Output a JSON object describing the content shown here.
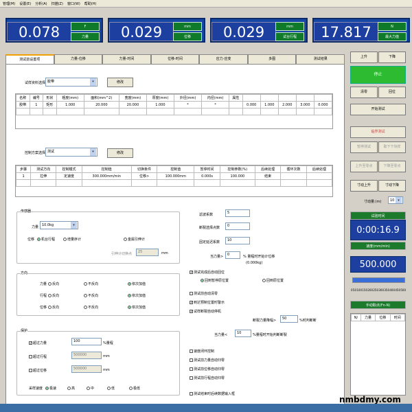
{
  "menu": [
    "管理(M)",
    "设置(E)",
    "分析(A)",
    "扫描(Z)",
    "窗口(W)",
    "帮助(H)"
  ],
  "displays": [
    {
      "value": "0.078",
      "top_label": "F",
      "name": "力量"
    },
    {
      "value": "0.029",
      "top_label": "mm",
      "name": "位移"
    },
    {
      "value": "0.029",
      "top_label": "mm",
      "name": "试台行程"
    },
    {
      "value": "17.817",
      "top_label": "N",
      "name": "最大力值"
    }
  ],
  "tabs": [
    "测试前设置项",
    "力量-位移",
    "力量-时间",
    "位移-时间",
    "应力-应变",
    "多图",
    "测试结果"
  ],
  "sample": {
    "label": "试样资料选择",
    "select": "胶带",
    "button": "修改",
    "headers": [
      "名称",
      "编号",
      "形状",
      "粗度(mm)",
      "面积(mm^2)",
      "宽度(mm)",
      "厚度(mm)",
      "外径(mm)",
      "内径(mm)",
      "属性",
      "",
      "",
      "",
      "",
      ""
    ],
    "row": [
      "胶带",
      "1",
      "矩形",
      "1.000",
      "20.000",
      "20.000",
      "1.000",
      "*",
      "*",
      "",
      "0.000",
      "1.000",
      "2.000",
      "3.000",
      "0.000"
    ]
  },
  "control": {
    "label": "控制方案选择",
    "select": "测试",
    "button": "修改",
    "headers": [
      "步骤",
      "测试方向",
      "控制模式",
      "控制值",
      "切换条件",
      "控制值",
      "暂停时间",
      "控制参数(%)",
      "后续处理",
      "循环次数",
      "后续处理"
    ],
    "row": [
      "1",
      "拉伸",
      "定速度",
      "300.000mm/min",
      "位移>",
      "100.000mm",
      "0.000s",
      "100.000",
      "结束",
      "",
      ""
    ]
  },
  "sensor": {
    "title": "传感器",
    "force_label": "力量",
    "force_value": "10.0kg",
    "disp_label": "位移",
    "disp_opts": [
      "机台行程",
      "增量序计",
      "金属引伸计"
    ],
    "ext_label": "引伸计切换点",
    "ext_value": "25",
    "ext_unit": "mm"
  },
  "direction": {
    "title": "方向",
    "rows": [
      {
        "name": "力量",
        "opts": [
          "反向",
          "不反向",
          "依次加值"
        ]
      },
      {
        "name": "行程",
        "opts": [
          "反向",
          "不反向",
          "依次加值"
        ]
      },
      {
        "name": "位移",
        "opts": [
          "反向",
          "不反向",
          "依次加值"
        ]
      }
    ]
  },
  "protect": {
    "title": "保护",
    "rows": [
      {
        "name": "超过力量",
        "value": "100",
        "unit": "%量程"
      },
      {
        "name": "超过行程",
        "value": "500000",
        "unit": "mm"
      },
      {
        "name": "超过位移",
        "value": "500000",
        "unit": "mm"
      }
    ],
    "rate_label": "采样速度",
    "rates": [
      "极速",
      "高",
      "中",
      "低",
      "极低"
    ]
  },
  "params": [
    {
      "label": "滤波系数",
      "value": "5"
    },
    {
      "label": "断裂选择点数",
      "value": "0"
    },
    {
      "label": "固定延迟系数",
      "value": "10"
    },
    {
      "label": "当力量>",
      "value": "0",
      "unit": "% 量程时开始计位移"
    }
  ],
  "params_unit": "(0.000kg)",
  "checks": [
    {
      "label": "测试完成后自动回位",
      "on": true
    },
    {
      "label": "测试前自动清零",
      "on": false
    },
    {
      "label": "到达预制位置时警示",
      "on": true
    },
    {
      "label": "试样断裂自动停机",
      "on": true
    },
    {
      "label": "速度闭环控制",
      "on": false
    },
    {
      "label": "测试前力量自动归零",
      "on": false
    },
    {
      "label": "测试前位移自动归零",
      "on": false
    },
    {
      "label": "测试前行程自动归零",
      "on": false
    },
    {
      "label": "测试结束时后续数据输入框",
      "on": false
    }
  ],
  "return_opts": [
    "回到暂停原位置",
    "回到原位置"
  ],
  "break": {
    "label": "断裂力量降幅>",
    "value": "50",
    "unit": "%时判断断"
  },
  "when_force": {
    "label": "当力量<",
    "value": "10",
    "unit": "%量程时开始判断断裂"
  },
  "right": {
    "up": "上升",
    "down": "下降",
    "stop": "停止",
    "clear": "清零",
    "home": "回位",
    "start": "开始测试",
    "review": "临界测试",
    "pause": "暂停测试",
    "next": "取下下块样",
    "up_fast": "上升至零点",
    "down_fast": "下降至零点",
    "jog_up": "寸动上升",
    "jog_down": "寸动下降",
    "jog_label": "寸动量:(m)",
    "jog_value": "10",
    "time_title": "试验时间",
    "time_value": "0:00:16.9",
    "speed_title": "速度(mm/min)",
    "speed_value": "500.000",
    "scale": [
      "0",
      "50",
      "100",
      "150",
      "200",
      "250",
      "300",
      "350",
      "400",
      "450",
      "500"
    ],
    "points_title": "手动取点(Fn-N)",
    "points_headers": [
      "N/",
      "力量",
      "位移",
      "时间"
    ],
    "points_value": 500
  },
  "watermark": "nmbdmy.com"
}
